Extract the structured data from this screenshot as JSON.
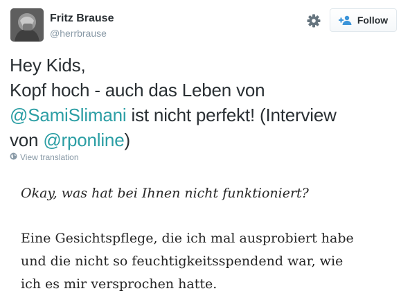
{
  "user": {
    "fullname": "Fritz Brause",
    "username": "@herrbrause",
    "follow_label": "Follow"
  },
  "tweet": {
    "lines": [
      [
        {
          "text": "Hey Kids,"
        }
      ],
      [
        {
          "text": "Kopf hoch - auch das Leben von"
        }
      ],
      [
        {
          "text": "@SamiSlimani",
          "mention": true
        },
        {
          "text": " ist nicht perfekt! (Interview"
        }
      ],
      [
        {
          "text": "von "
        },
        {
          "text": "@rponline",
          "mention": true
        },
        {
          "text": ")"
        }
      ]
    ],
    "translate_label": "View translation"
  },
  "photo": {
    "question": "Okay, was hat bei Ihnen nicht funktioniert?",
    "answer_lines": [
      "Eine Gesichtspflege, die ich mal ausprobiert habe",
      "und die nicht so feuchtigkeitsspendend war, wie",
      "ich es mir versprochen hatte."
    ]
  },
  "colors": {
    "link": "#2b9ea4",
    "muted": "#8899a6",
    "text": "#292f33"
  },
  "icons": [
    "gear-icon",
    "follow-person-icon",
    "globe-icon"
  ]
}
